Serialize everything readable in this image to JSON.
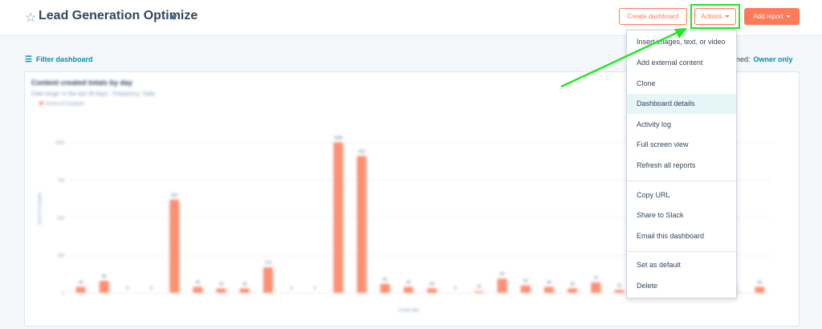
{
  "header": {
    "title": "Lead Generation Optimize",
    "create_dashboard": "Create dashboard",
    "actions": "Actions",
    "add_report": "Add report"
  },
  "filter": {
    "label": "Filter dashboard",
    "assigned_label": "gned:",
    "assigned_value": "Owner only"
  },
  "report": {
    "title": "Content created totals by day",
    "subtitle": "Date range: In the last 30 days · Frequency: Daily",
    "legend": "Count of Contacts"
  },
  "menu": {
    "items": [
      "Insert images, text, or video",
      "Add external content",
      "Clone",
      "Dashboard details",
      "Activity log",
      "Full screen view",
      "Refresh all reports",
      "Copy URL",
      "Share to Slack",
      "Email this dashboard",
      "Set as default",
      "Delete"
    ],
    "active": "Dashboard details"
  },
  "colors": {
    "accent": "#ff7a59",
    "bar": "#ff8f73",
    "link": "#0091ae",
    "highlight": "#21e821"
  },
  "chart_data": {
    "type": "bar",
    "ylim": [
      0,
      1200
    ],
    "ylabel": "Count of Contacts",
    "xlabel": "Create date",
    "yticks": [
      0,
      250,
      500,
      750,
      1000
    ],
    "values": [
      40,
      80,
      0,
      0,
      620,
      40,
      30,
      30,
      170,
      0,
      0,
      1000,
      910,
      60,
      40,
      30,
      0,
      10,
      95,
      50,
      40,
      30,
      70,
      20,
      10,
      0,
      15,
      10,
      5,
      40
    ]
  }
}
